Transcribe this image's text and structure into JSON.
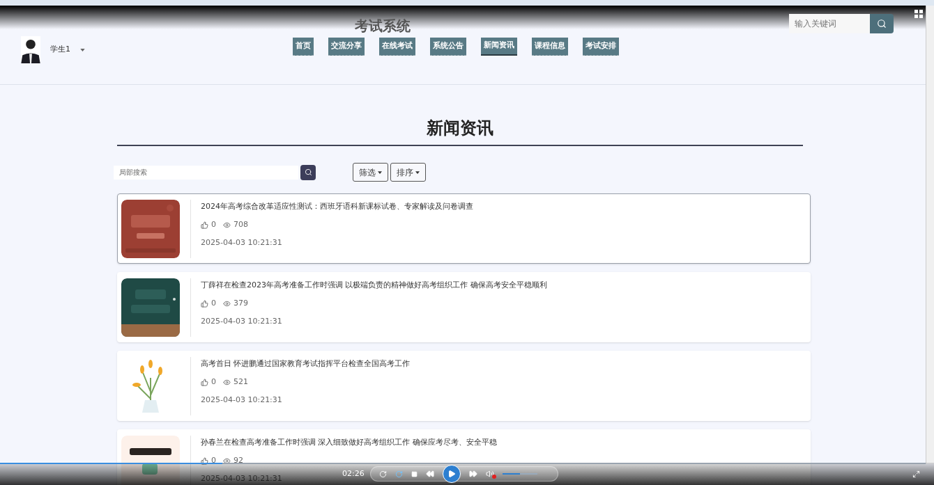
{
  "header": {
    "title": "考试系统",
    "search": {
      "placeholder": "输入关键词"
    },
    "user": {
      "name": "学生1"
    },
    "nav": [
      {
        "label": "首页",
        "selected": false
      },
      {
        "label": "交流分享",
        "selected": false
      },
      {
        "label": "在线考试",
        "selected": false
      },
      {
        "label": "系统公告",
        "selected": false
      },
      {
        "label": "新闻资讯",
        "selected": true
      },
      {
        "label": "课程信息",
        "selected": false
      },
      {
        "label": "考试安排",
        "selected": false
      }
    ]
  },
  "page": {
    "title": "新闻资讯",
    "search": {
      "placeholder": "局部搜索"
    },
    "filters": [
      {
        "label": "筛选"
      },
      {
        "label": "排序"
      }
    ]
  },
  "news": [
    {
      "title": "2024年高考综合改革适应性测试：西班牙语科新课标试卷、专家解读及问卷调查",
      "likes": "0",
      "views": "708",
      "date": "2025-04-03 10:21:31",
      "selected": true
    },
    {
      "title": "丁薛祥在检查2023年高考准备工作时强调 以极端负责的精神做好高考组织工作 确保高考安全平稳顺利",
      "likes": "0",
      "views": "379",
      "date": "2025-04-03 10:21:31",
      "selected": false
    },
    {
      "title": "高考首日 怀进鹏通过国家教育考试指挥平台检查全国高考工作",
      "likes": "0",
      "views": "521",
      "date": "2025-04-03 10:21:31",
      "selected": false
    },
    {
      "title": "孙春兰在检查高考准备工作时强调 深入细致做好高考组织工作 确保应考尽考、安全平稳",
      "likes": "0",
      "views": "92",
      "date": "2025-04-03 10:21:31",
      "selected": false
    }
  ],
  "player": {
    "time": "02:26",
    "progress": {
      "level": 0.24
    },
    "volume": {
      "level": 0.5
    },
    "muted": true
  }
}
